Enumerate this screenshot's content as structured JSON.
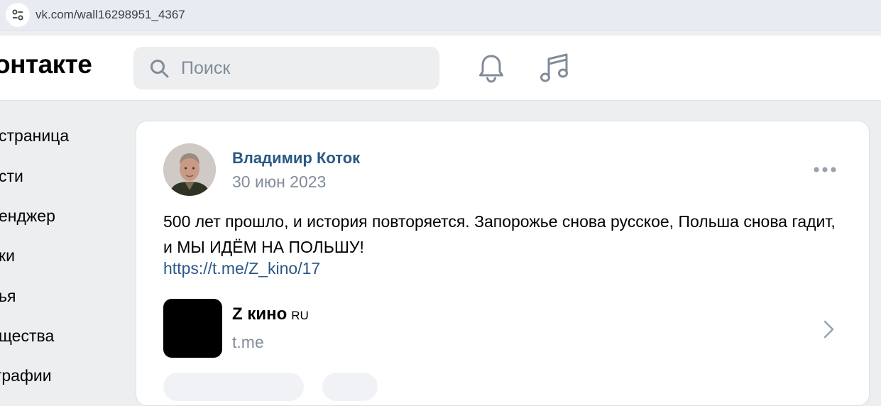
{
  "browser": {
    "url": "vk.com/wall16298951_4367",
    "site_icon": "tune-icon"
  },
  "header": {
    "logo": "онтакте",
    "search_placeholder": "Поиск",
    "icons": [
      "bell-icon",
      "music-icon"
    ]
  },
  "sidebar": {
    "items": [
      {
        "label": "страница"
      },
      {
        "label": "сти"
      },
      {
        "label": "енджер"
      },
      {
        "label": "ки"
      },
      {
        "label": "ья"
      },
      {
        "label": "щества"
      },
      {
        "label": "графии"
      }
    ]
  },
  "post": {
    "author": "Владимир Коток",
    "date": "30 июн 2023",
    "text": "500 лет прошло, и история повторяется. Запорожье снова русское, Польша снова гадит, и МЫ ИДЁМ НА ПОЛЬШУ!",
    "link": "https://t.me/Z_kino/17",
    "snippet": {
      "title": "Z кино",
      "badge": "RU",
      "domain": "t.me"
    }
  },
  "colors": {
    "link": "#2a5885",
    "secondary": "#818c99",
    "background": "#edeef0"
  }
}
